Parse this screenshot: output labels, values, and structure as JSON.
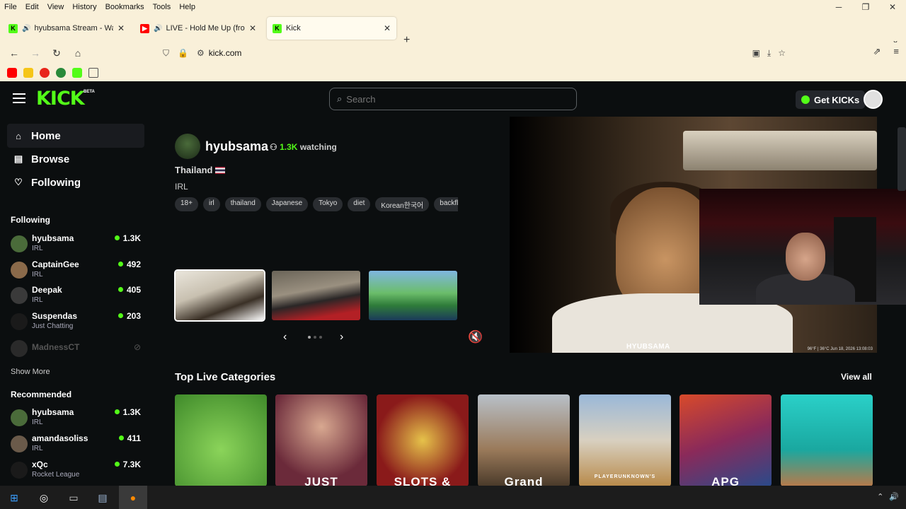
{
  "browser": {
    "menu": [
      "File",
      "Edit",
      "View",
      "History",
      "Bookmarks",
      "Tools",
      "Help"
    ],
    "window_controls": [
      "─",
      "❐",
      "✕"
    ],
    "tabs": [
      {
        "title": "hyubsama Stream - Watch L",
        "favicon": "kick",
        "audio": true,
        "close": "✕"
      },
      {
        "title": "LIVE - Hold Me Up (from Za",
        "favicon": "youtube",
        "audio": true,
        "close": "✕"
      },
      {
        "title": "Kick",
        "favicon": "kick",
        "audio": false,
        "close": "✕"
      }
    ],
    "new_tab": "+",
    "tab_list": "⌄",
    "url": "kick.com",
    "bookmark_icons": [
      "youtube",
      "imdb",
      "tomato",
      "game",
      "kick",
      "folder"
    ]
  },
  "kick": {
    "logo": "KICK",
    "beta": "BETA",
    "search": {
      "placeholder": "Search"
    },
    "get_kicks": "Get KICKs",
    "nav": [
      {
        "label": "Home",
        "icon": "home-icon"
      },
      {
        "label": "Browse",
        "icon": "browse-icon"
      },
      {
        "label": "Following",
        "icon": "heart-icon"
      }
    ],
    "following_header": "Following",
    "following": [
      {
        "name": "hyubsama",
        "category": "IRL",
        "viewers": "1.3K"
      },
      {
        "name": "CaptainGee",
        "category": "IRL",
        "viewers": "492"
      },
      {
        "name": "Deepak",
        "category": "IRL",
        "viewers": "405"
      },
      {
        "name": "Suspendas",
        "category": "Just Chatting",
        "viewers": "203"
      },
      {
        "name": "MadnessCT",
        "category": "",
        "viewers": ""
      }
    ],
    "show_more": "Show More",
    "recommended_header": "Recommended",
    "recommended": [
      {
        "name": "hyubsama",
        "category": "IRL",
        "viewers": "1.3K"
      },
      {
        "name": "amandasoliss",
        "category": "IRL",
        "viewers": "411"
      },
      {
        "name": "xQc",
        "category": "Rocket League",
        "viewers": "7.3K"
      }
    ],
    "featured": {
      "streamer": "hyubsama",
      "watching_count": "1.3K",
      "watching_label": "watching",
      "title": "Thailand",
      "category": "IRL",
      "tags": [
        "18+",
        "irl",
        "thailand",
        "Japanese",
        "Tokyo",
        "diet",
        "Korean한국어",
        "backfli"
      ],
      "overlay_name": "HYUBSAMA",
      "overlay_stats": "96°F | 36°C  Jun 18, 2026  13:08:03"
    },
    "top_categories": {
      "title": "Top Live Categories",
      "view_all": "View all",
      "cards": [
        "",
        "JUST",
        "SLOTS &",
        "Grand",
        "PLAYERUNKNOWN'S",
        "APG",
        ""
      ]
    }
  }
}
